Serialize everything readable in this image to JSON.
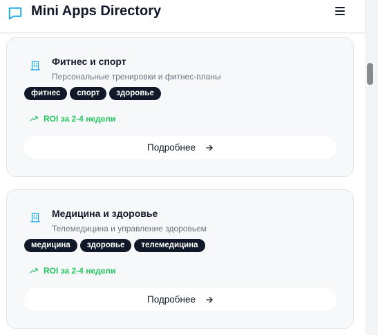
{
  "app": {
    "title": "Mini Apps Directory"
  },
  "icons": {
    "logo": "chat-bubble-icon",
    "menu": "hamburger-menu-icon",
    "card": "building-icon",
    "roi": "trending-up-icon",
    "arrow": "arrow-right-icon"
  },
  "colors": {
    "accent": "#0ea5e9",
    "tag_bg": "#111827",
    "roi_green": "#22c55e"
  },
  "cards": [
    {
      "title": "Фитнес и спорт",
      "description": "Персональные тренировки и фитнес-планы",
      "tags": [
        "фитнес",
        "спорт",
        "здоровье"
      ],
      "roi": "ROI за 2-4 недели",
      "button": "Подробнее"
    },
    {
      "title": "Медицина и здоровье",
      "description": "Телемедицина и управление здоровьем",
      "tags": [
        "медицина",
        "здоровье",
        "телемедицина"
      ],
      "roi": "ROI за 2-4 недели",
      "button": "Подробнее"
    }
  ]
}
